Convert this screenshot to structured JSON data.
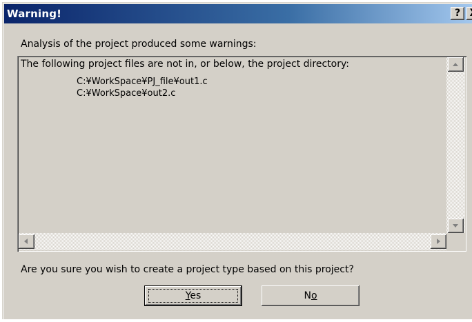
{
  "window": {
    "title": "Warning!",
    "help_glyph": "?",
    "close_glyph": "X"
  },
  "intro_label": "Analysis of the project produced some warnings:",
  "warnings_box": {
    "header": "The following project files are not in, or below, the project directory:",
    "paths": [
      "C:¥WorkSpace¥PJ_file¥out1.c",
      "C:¥WorkSpace¥out2.c"
    ]
  },
  "question_label": "Are you sure you wish to create a project type based on this project?",
  "buttons": {
    "yes": {
      "mnemonic": "Y",
      "rest": "es"
    },
    "no": {
      "lead": "N",
      "mnemonic": "o"
    }
  }
}
